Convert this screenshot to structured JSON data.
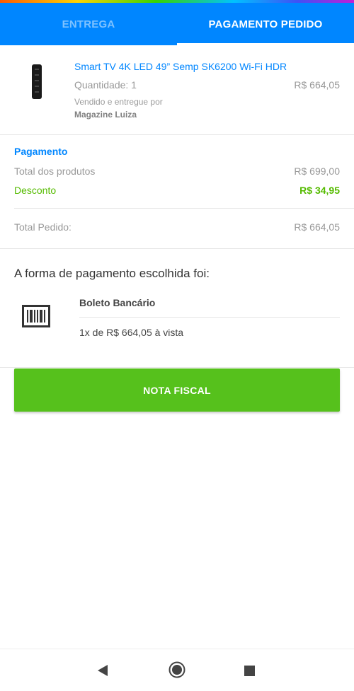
{
  "tabs": [
    {
      "label": "ENTREGA",
      "active": false
    },
    {
      "label": "PAGAMENTO PEDIDO",
      "active": true
    }
  ],
  "product": {
    "name": "Smart TV 4K LED 49” Semp SK6200 Wi-Fi HDR",
    "quantity": "Quantidade: 1",
    "price": "R$ 664,05",
    "sold_by": "Vendido e entregue por",
    "seller": "Magazine Luiza",
    "image_icon": "tv-remote-icon"
  },
  "payment": {
    "title": "Pagamento",
    "total_products_label": "Total dos produtos",
    "total_products_value": "R$ 699,00",
    "discount_label": "Desconto",
    "discount_value": "R$ 34,95",
    "order_total_label": "Total Pedido:",
    "order_total_value": "R$ 664,05"
  },
  "method": {
    "heading": "A forma de pagamento escolhida foi:",
    "name": "Boleto Bancário",
    "detail": "1x de R$ 664,05 à vista",
    "icon": "barcode-icon"
  },
  "actions": {
    "invoice_label": "NOTA FISCAL"
  },
  "colors": {
    "primary": "#0086ff",
    "success": "#56c11c",
    "discount": "#55bb00"
  },
  "navbar": {
    "icons": [
      "back-icon",
      "home-icon",
      "recents-icon"
    ]
  }
}
